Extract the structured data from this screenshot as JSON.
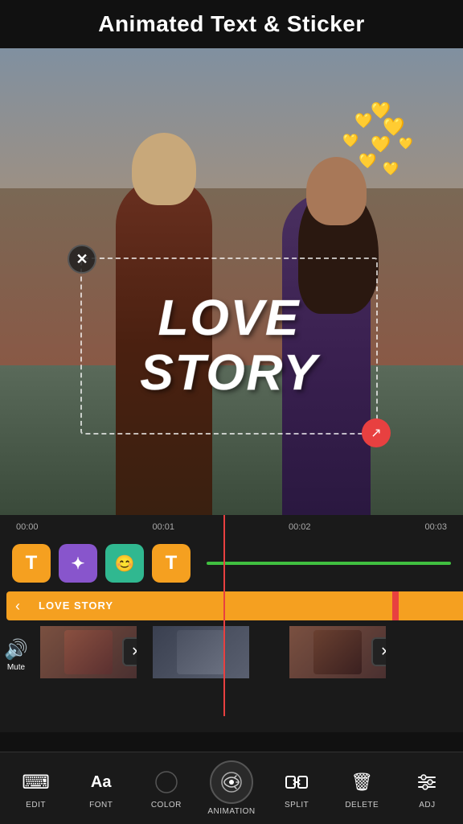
{
  "header": {
    "title": "Animated Text & Sticker"
  },
  "video": {
    "text_overlay": {
      "line1": "LOVE",
      "line2": "STORY"
    }
  },
  "timeline": {
    "ruler": {
      "marks": [
        "00:00",
        "00:01",
        "00:02",
        "00:03"
      ]
    },
    "clip_label": "LOVE STORY"
  },
  "mute": {
    "label": "Mute"
  },
  "toolbar": {
    "items": [
      {
        "id": "edit",
        "label": "EDIT",
        "icon": "⌨"
      },
      {
        "id": "font",
        "label": "FONT",
        "icon": "Aa"
      },
      {
        "id": "color",
        "label": "COLOR",
        "icon": "◑"
      },
      {
        "id": "animation",
        "label": "ANIMATION",
        "icon": "⚙"
      },
      {
        "id": "split",
        "label": "SPLIT",
        "icon": "⊣⊢"
      },
      {
        "id": "delete",
        "label": "DELETE",
        "icon": "🗑"
      },
      {
        "id": "adj",
        "label": "ADJ",
        "icon": "≡"
      }
    ]
  },
  "hearts": [
    "💛",
    "💛",
    "💛",
    "💛",
    "💛",
    "💛",
    "💛",
    "💛"
  ]
}
